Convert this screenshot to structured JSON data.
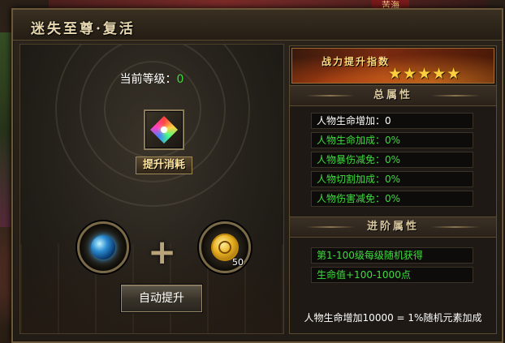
{
  "hud": {
    "top_label": "苦海"
  },
  "window": {
    "title": "迷失至尊·复活"
  },
  "left": {
    "level_label": "当前等级：",
    "level_value": "0",
    "cost_label": "提升消耗",
    "material_count": "50",
    "plus_symbol": "+",
    "upgrade_button": "自动提升",
    "icons": {
      "result_item": "rainbow-gem-icon",
      "material_1": "blue-orb-icon",
      "material_2": "gold-coin-icon"
    }
  },
  "right": {
    "banner_title": "战力提升指数",
    "star_rating": 5,
    "stars_text": "★★★★★",
    "total_attrs_title": "总属性",
    "total_attrs": [
      "人物生命增加：0",
      "人物生命加成：0%",
      "人物暴伤减免：0%",
      "人物切割加成：0%",
      "人物伤害减免：0%"
    ],
    "advanced_attrs_title": "进阶属性",
    "advanced_attrs": [
      "第1-100级每级随机获得",
      "生命值+100-1000点"
    ],
    "footer_note": "人物生命增加10000 = 1%随机元素加成"
  },
  "colors": {
    "accent_green": "#3cdc3c",
    "star_gold": "#ffcf40",
    "frame_bronze": "#6b5838"
  }
}
